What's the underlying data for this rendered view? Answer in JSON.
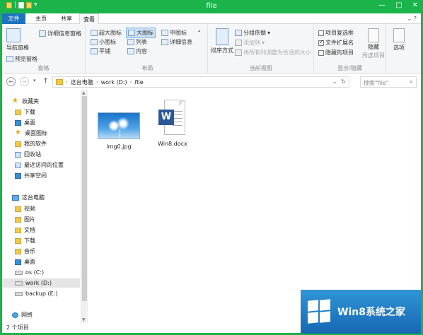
{
  "window": {
    "title": "file",
    "controls": [
      "—",
      "□",
      "✕"
    ]
  },
  "tabs": {
    "file": "文件",
    "home": "主页",
    "share": "共享",
    "view": "查看",
    "help": "⌄ ?"
  },
  "ribbon": {
    "pane": {
      "nav_pane": "导航窗格",
      "preview_pane": "预览窗格",
      "details_pane": "详细信息窗格",
      "label": "窗格"
    },
    "layout": {
      "extra_large": "超大图标",
      "large": "大图标",
      "medium": "中图标",
      "small": "小图标",
      "list": "列表",
      "details": "详细信息",
      "tiles": "平铺",
      "content": "内容",
      "label": "布局"
    },
    "current_view": {
      "sort_by": "排序方式",
      "group_by": "分组依据",
      "add_columns": "添加列",
      "size_all_columns": "将所有列调整为合适的大小",
      "label": "当前视图"
    },
    "show_hide": {
      "item_checkboxes": "项目复选框",
      "file_extensions": "文件扩展名",
      "hidden_items": "隐藏的项目",
      "hide": "隐藏",
      "selected_items": "所选项目",
      "label": "显示/隐藏",
      "item_checkboxes_checked": false,
      "file_extensions_checked": true,
      "hidden_items_checked": false
    },
    "options": {
      "label": "选项"
    }
  },
  "address": {
    "crumbs": [
      "这台电脑",
      "work (D:)",
      "file"
    ],
    "search_placeholder": "搜索\"file\""
  },
  "nav": {
    "favorites": "收藏夹",
    "downloads": "下载",
    "desktop": "桌面",
    "desktop_icons": "桌面图标",
    "my_software": "我的软件",
    "recycle": "回收站",
    "recent_places": "最近访问的位置",
    "shared_space": "共享空间",
    "this_pc": "这台电脑",
    "videos": "视频",
    "pictures": "图片",
    "documents": "文档",
    "pc_downloads": "下载",
    "music": "音乐",
    "pc_desktop": "桌面",
    "drive_c": "os (C:)",
    "drive_d": "work (D:)",
    "drive_e": "backup (E:)",
    "network": "网络"
  },
  "files": [
    {
      "name": "img0.jpg",
      "icon": "image-thumbnail"
    },
    {
      "name": "Win8.docx",
      "icon": "word-document-icon"
    }
  ],
  "status": {
    "count": "2 个项目"
  },
  "watermark": {
    "text": "Win8系统之家"
  },
  "colors": {
    "accent_green": "#1bb44a",
    "file_tab_blue": "#1e73be",
    "word_blue": "#2b5797"
  }
}
